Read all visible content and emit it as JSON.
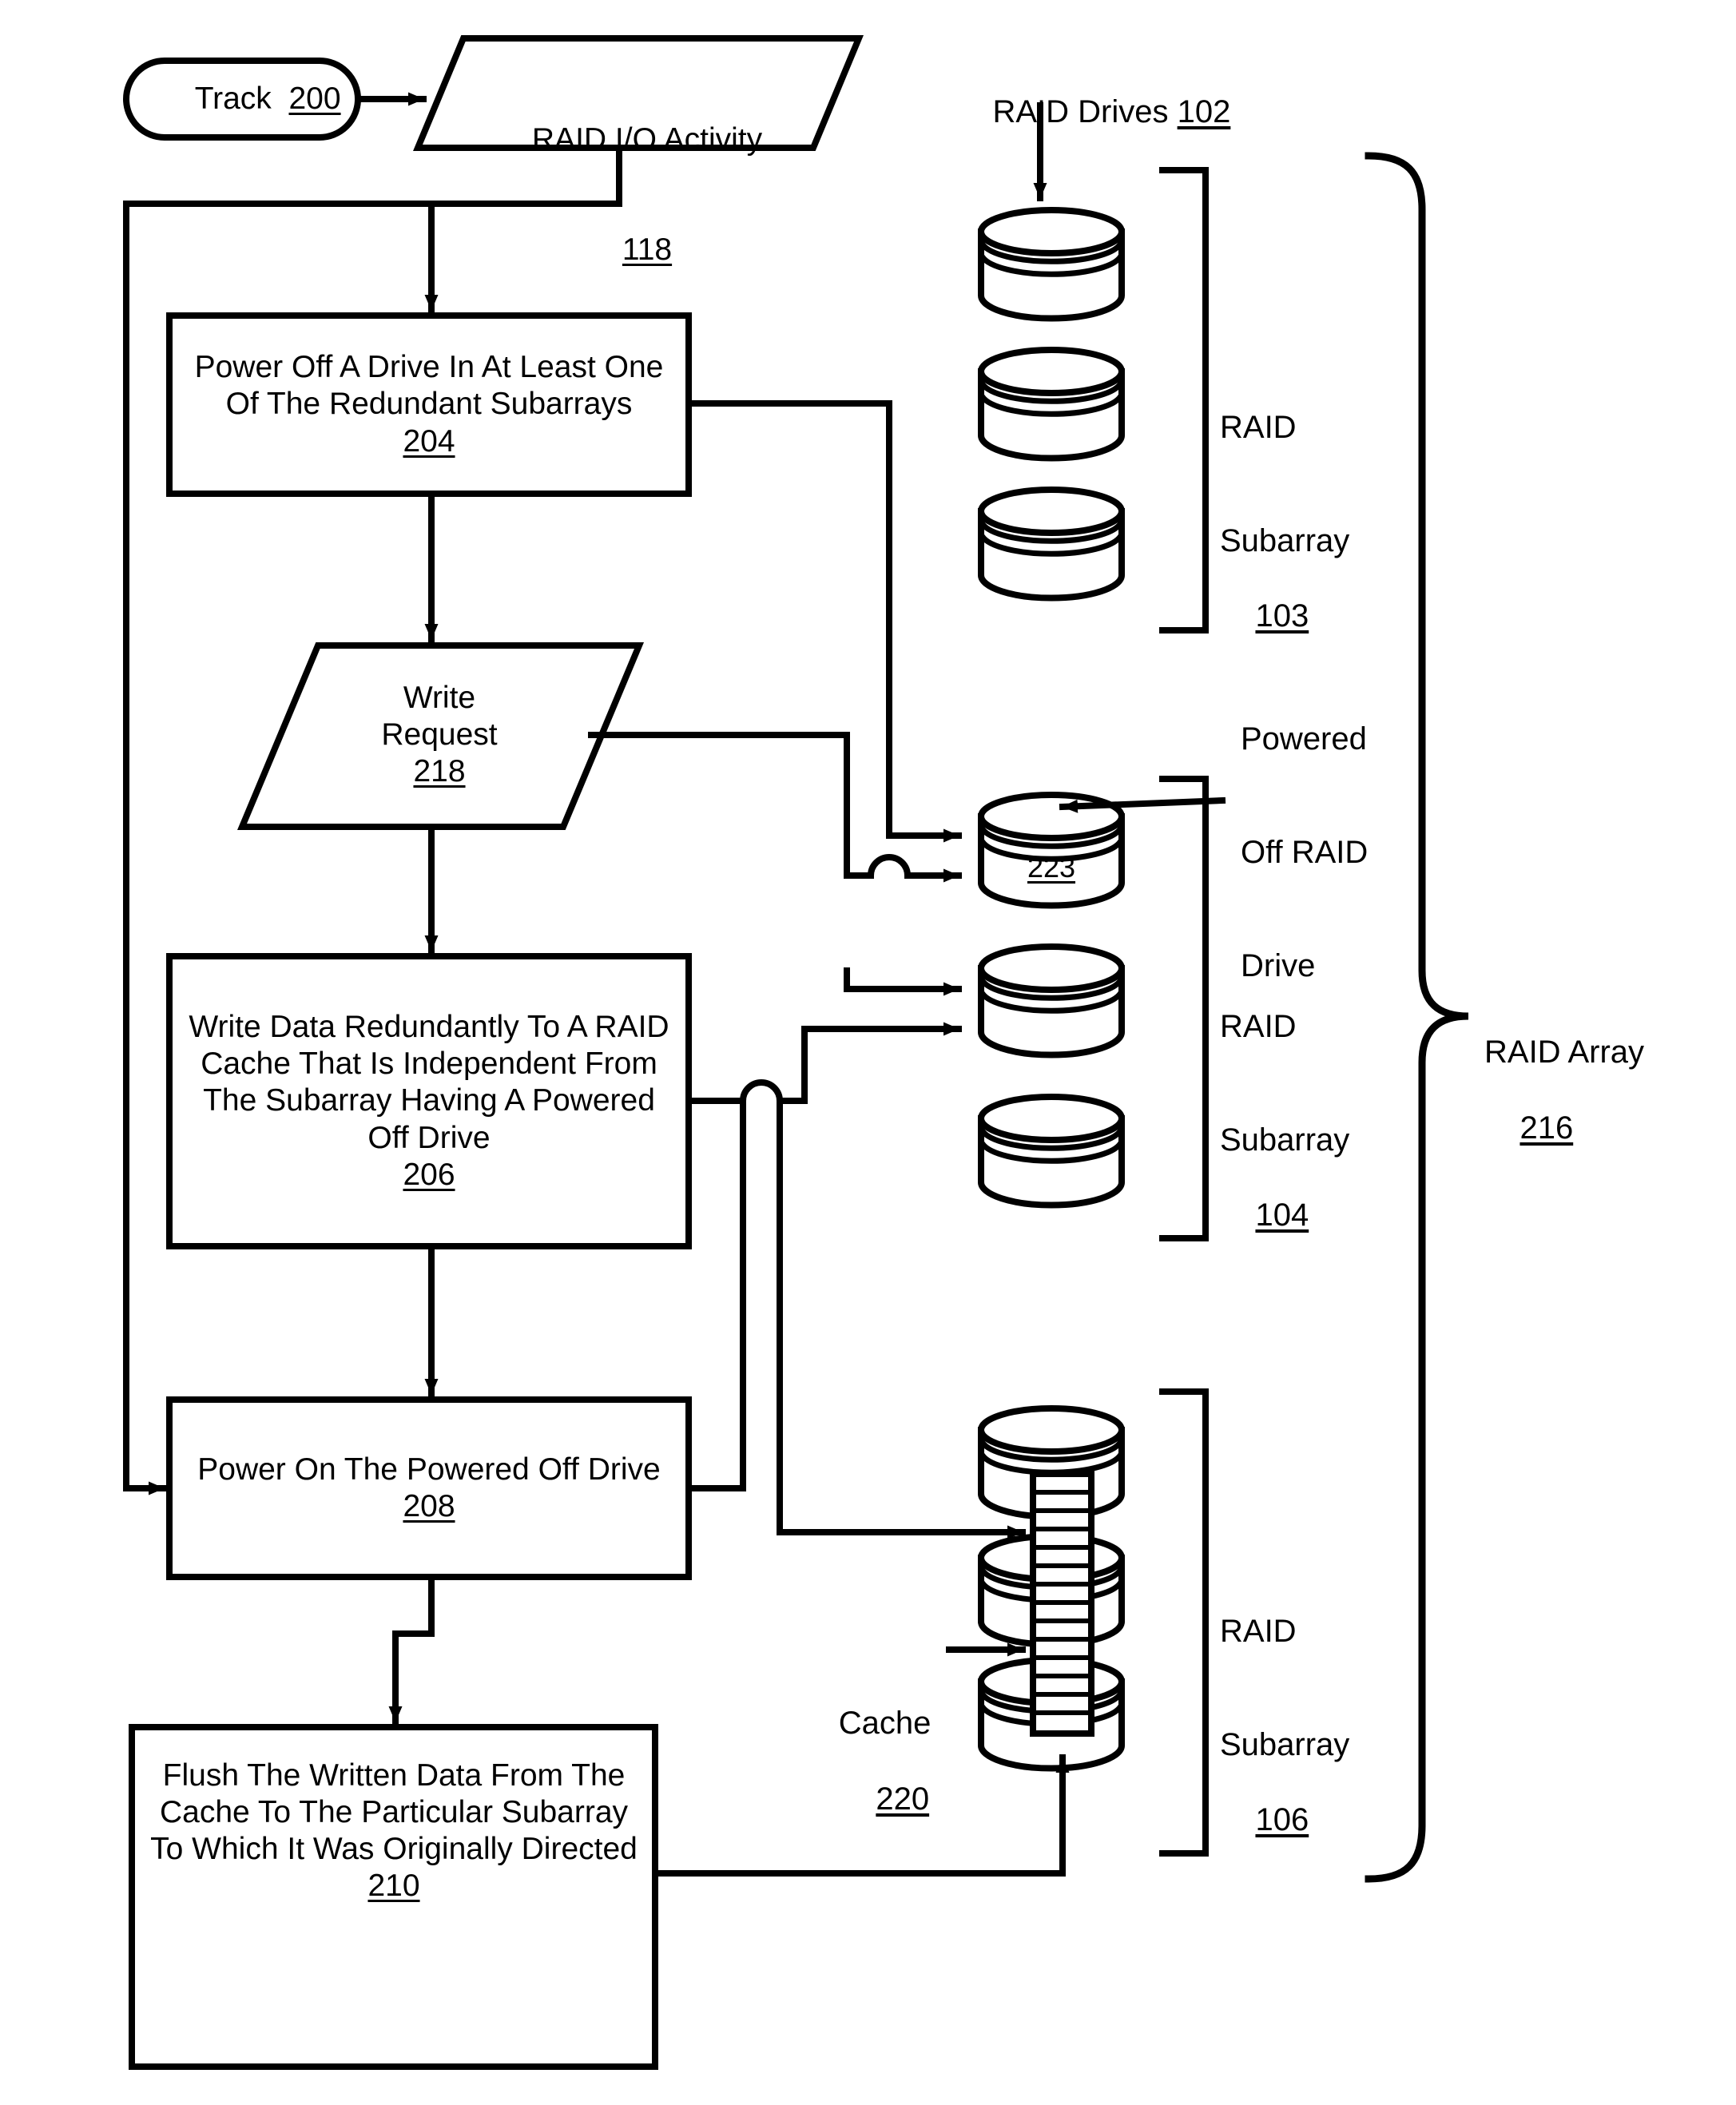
{
  "figure": {
    "title": "RAID power management flowchart",
    "stroke_color": "#000000",
    "background_color": "#ffffff"
  },
  "flow": {
    "start": {
      "label": "Track",
      "ref": "200"
    },
    "io_activity": {
      "label": "RAID I/O Activity",
      "ref": "118"
    },
    "step_power_off": {
      "label": "Power Off A Drive In At Least One Of The Redundant Subarrays",
      "ref": "204"
    },
    "write_request": {
      "label": "Write Request",
      "ref": "218"
    },
    "step_write_cache": {
      "label": "Write Data Redundantly To A RAID Cache That Is Independent From The Subarray Having A Powered Off Drive",
      "ref": "206"
    },
    "step_power_on": {
      "label": "Power On The Powered Off Drive",
      "ref": "208"
    },
    "step_flush": {
      "label": "Flush The Written Data From The Cache To The Particular Subarray To Which It Was Originally Directed",
      "ref": "210"
    }
  },
  "hardware": {
    "raid_drives": {
      "label": "RAID Drives",
      "ref": "102"
    },
    "subarray_103": {
      "label_line1": "RAID",
      "label_line2": "Subarray",
      "ref": "103"
    },
    "subarray_104": {
      "label_line1": "RAID",
      "label_line2": "Subarray",
      "ref": "104"
    },
    "subarray_106": {
      "label_line1": "RAID",
      "label_line2": "Subarray",
      "ref": "106"
    },
    "powered_off_drive": {
      "label_line1": "Powered",
      "label_line2": "Off RAID",
      "label_line3": "Drive",
      "drive_ref": "223"
    },
    "cache": {
      "label": "Cache",
      "ref": "220"
    },
    "raid_array": {
      "label": "RAID Array",
      "ref": "216"
    }
  }
}
